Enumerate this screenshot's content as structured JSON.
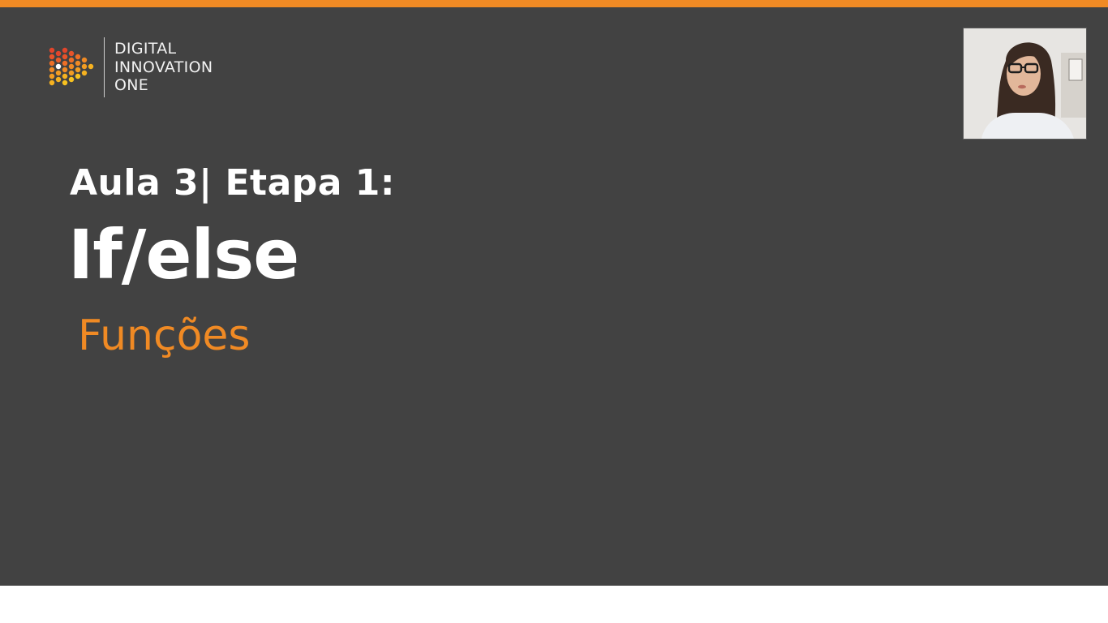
{
  "brand": {
    "lines": [
      "DIGITAL",
      "INNOVATION",
      "ONE"
    ],
    "accent_color": "#f08a24",
    "background_color": "#424242"
  },
  "slide": {
    "heading": "Aula 3|  Etapa 1:",
    "title": "If/else",
    "subtitle": "Funções"
  },
  "webcam": {
    "icon": "presenter-video-feed"
  }
}
